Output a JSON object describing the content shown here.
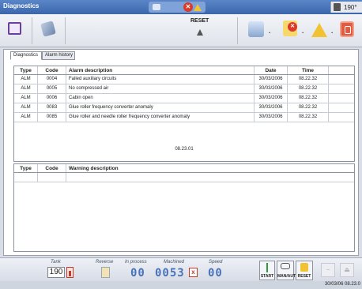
{
  "window": {
    "title": "Diagnostics",
    "temperature": "190°"
  },
  "toolbar": {
    "reset_label": "RESET",
    "dropdown_glyph": "·"
  },
  "tabs": [
    {
      "label": "Diagnostics",
      "active": true
    },
    {
      "label": "Alarm history",
      "active": false
    }
  ],
  "alarms": {
    "headers": {
      "type": "Type",
      "code": "Code",
      "desc": "Alarm description",
      "date": "Date",
      "time": "Time"
    },
    "rows": [
      {
        "type": "ALM",
        "code": "0004",
        "desc": "Failed auxiliary circuits",
        "date": "30/03/2006",
        "time": "08.22.32"
      },
      {
        "type": "ALM",
        "code": "0005",
        "desc": "No compressed air",
        "date": "30/03/2006",
        "time": "08.22.32"
      },
      {
        "type": "ALM",
        "code": "0006",
        "desc": "Cabin open",
        "date": "30/03/2006",
        "time": "08.22.32"
      },
      {
        "type": "ALM",
        "code": "0083",
        "desc": "Glue roller frequency converter anomaly",
        "date": "30/03/2006",
        "time": "08.22.32"
      },
      {
        "type": "ALM",
        "code": "0085",
        "desc": "Glue roller and needle roller frequency converter anomaly",
        "date": "30/03/2006",
        "time": "08.22.32"
      }
    ],
    "clock": "08.23.01"
  },
  "warnings": {
    "headers": {
      "type": "Type",
      "code": "Code",
      "desc": "Warning description"
    }
  },
  "status": {
    "tank_label": "Tank",
    "tank_value": "190",
    "reverse_label": "Reverse",
    "in_process_label": "In process",
    "in_process_value": "00",
    "machined_label": "Machined",
    "machined_value": "0053",
    "speed_label": "Speed",
    "speed_value": "00",
    "x_mark": "x",
    "start_label": "START",
    "manaut_label": "MAN/AUT",
    "reset_label": "RESET",
    "datetime": "30/03/06 08.23.0"
  }
}
